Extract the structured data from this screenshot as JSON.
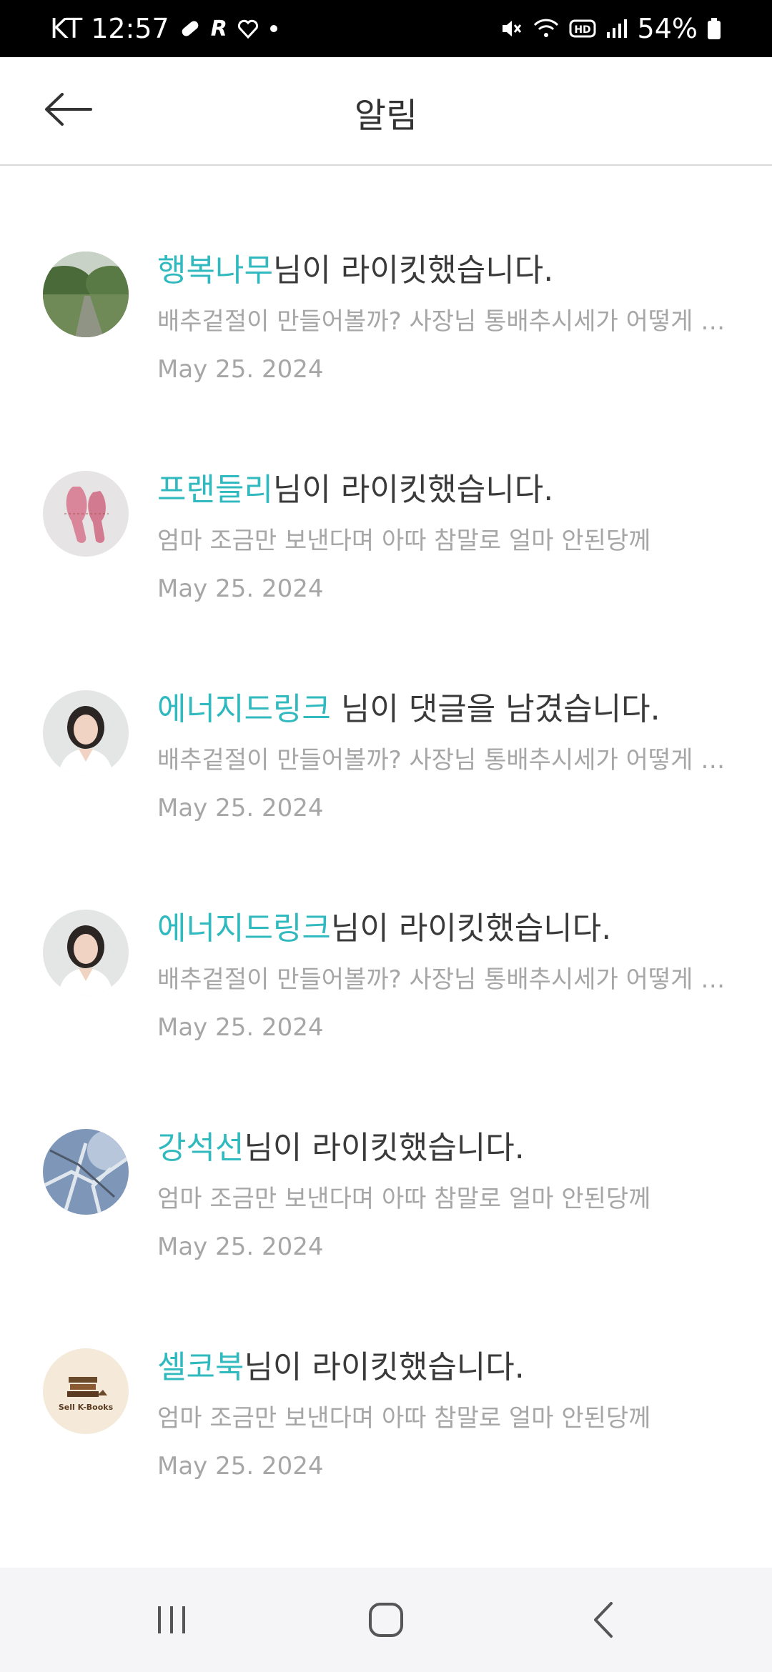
{
  "status_bar": {
    "carrier": "KT",
    "time": "12:57",
    "battery": "54%",
    "left_icons": [
      "pill-icon",
      "r-app-icon",
      "heart-app-icon",
      "dot-icon"
    ],
    "right_icons": [
      "mute-icon",
      "wifi-icon",
      "hd-icon",
      "signal-icon",
      "battery-icon"
    ]
  },
  "header": {
    "title": "알림",
    "back_icon": "arrow-left-icon"
  },
  "notifications": [
    {
      "username": "행복나무",
      "action": "님이 라이킷했습니다.",
      "preview": "배추겉절이 만들어볼까?  사장님 통배추시세가 어떻게 되나요?",
      "date": "May 25. 2024",
      "avatar": "tree-path-photo"
    },
    {
      "username": "프랜들리",
      "action": "님이 라이킷했습니다.",
      "preview": "엄마 조금만 보낸다며 아따 참말로 얼마 안된당께",
      "date": "May 25. 2024",
      "avatar": "ballet-shoes-photo"
    },
    {
      "username": "에너지드링크",
      "action": " 님이 댓글을 남겼습니다.",
      "preview": "배추겉절이 만들어볼까?  사장님 통배추시세가 어떻게 되나요?",
      "date": "May 25. 2024",
      "avatar": "woman-portrait-photo"
    },
    {
      "username": "에너지드링크",
      "action": "님이 라이킷했습니다.",
      "preview": "배추겉절이 만들어볼까?  사장님 통배추시세가 어떻게 되나요?",
      "date": "May 25. 2024",
      "avatar": "woman-portrait-photo"
    },
    {
      "username": "강석선",
      "action": "님이 라이킷했습니다.",
      "preview": "엄마 조금만 보낸다며 아따 참말로 얼마 안된당께",
      "date": "May 25. 2024",
      "avatar": "snowy-branches-photo"
    },
    {
      "username": "셀코북",
      "action": "님이 라이킷했습니다.",
      "preview": "엄마 조금만 보낸다며 아따 참말로 얼마 안된당께",
      "date": "May 25. 2024",
      "avatar": "sell-k-books-logo",
      "avatar_text": "Sell K-Books"
    }
  ],
  "nav_bar": {
    "recents_icon": "recents-icon",
    "home_icon": "home-icon",
    "back_icon": "back-chevron-icon"
  },
  "colors": {
    "accent": "#30b9be",
    "text_primary": "#3a3a3a",
    "text_secondary": "#a6a6a6",
    "status_bar": "#000000",
    "nav_bar": "#f5f5f7"
  }
}
